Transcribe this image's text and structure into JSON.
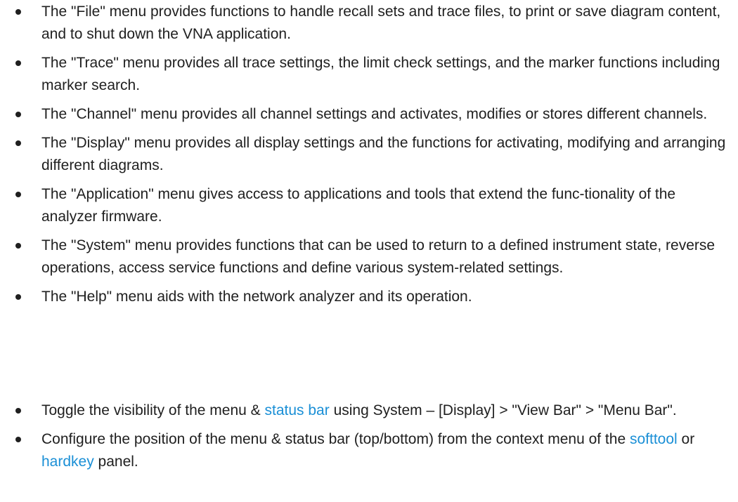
{
  "menu_descriptions": [
    {
      "text": "The \"File\" menu provides functions to handle recall sets and trace files, to print or save diagram content, and to shut down the VNA application."
    },
    {
      "text": "The \"Trace\" menu provides all trace settings, the limit check settings, and the marker functions including marker search."
    },
    {
      "text": "The \"Channel\" menu provides all channel settings and activates, modifies or stores different channels."
    },
    {
      "text": "The \"Display\" menu provides all display settings and the functions for activating, modifying and arranging different diagrams."
    },
    {
      "text": "The \"Application\" menu gives access to applications and tools that extend the func-tionality of the analyzer firmware."
    },
    {
      "text": "The \"System\" menu provides functions that can be used to return to a defined instrument state, reverse operations, access service functions and define various system-related settings."
    },
    {
      "text": "The \"Help\" menu aids with the network analyzer and its operation."
    }
  ],
  "tips": {
    "toggle": {
      "before": "Toggle the visibility of the menu & ",
      "link": "status bar",
      "after": " using System – [Display] > \"View Bar\" > \"Menu Bar\"."
    },
    "configure": {
      "before": "Configure the position of the menu & status bar (top/bottom) from the context menu of the ",
      "link1": "softtool",
      "middle": " or ",
      "link2": "hardkey",
      "after": " panel."
    }
  },
  "colors": {
    "text": "#1f1f1f",
    "link": "#1a8fd6"
  }
}
